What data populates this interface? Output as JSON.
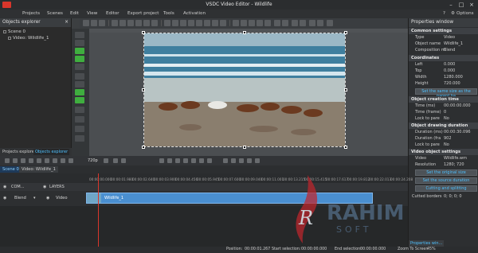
{
  "window": {
    "title": "VSDC Video Editor - Wildlife"
  },
  "menu": [
    "Projects",
    "Scenes",
    "Edit",
    "View",
    "Editor",
    "Export project",
    "Tools",
    "Activation"
  ],
  "menu_right": {
    "help": "?",
    "options": "Options"
  },
  "explorer": {
    "title": "Objects explorer",
    "close": "×",
    "tree": [
      {
        "label": "Scene 0"
      },
      {
        "label": "Video: Wildlife_1"
      }
    ],
    "tabs": [
      "Projects explorer",
      "Objects explorer"
    ]
  },
  "properties": {
    "title": "Properties window",
    "sections": [
      {
        "title": "Common settings",
        "rows": [
          {
            "key": "Type",
            "value": "Video"
          },
          {
            "key": "Object name",
            "value": "Wildlife_1"
          },
          {
            "key": "Composition m",
            "value": "Blend"
          }
        ]
      },
      {
        "title": "Coordinates",
        "rows": [
          {
            "key": "Left",
            "value": "0.000"
          },
          {
            "key": "Top",
            "value": "0.000"
          },
          {
            "key": "Width",
            "value": "1280.000"
          },
          {
            "key": "Height",
            "value": "720.000"
          }
        ],
        "button": "Set the same size as the parent ha"
      },
      {
        "title": "Object creation time",
        "rows": [
          {
            "key": "Time (ms)",
            "value": "00:00:00.000"
          },
          {
            "key": "Time (frame)",
            "value": "0"
          },
          {
            "key": "Lock to pare",
            "value": "No"
          }
        ]
      },
      {
        "title": "Object drawing duration",
        "rows": [
          {
            "key": "Duration (ms)",
            "value": "00:00:30.096"
          },
          {
            "key": "Duration (fra",
            "value": "902"
          },
          {
            "key": "Lock to pare",
            "value": "No"
          }
        ]
      },
      {
        "title": "Video object settings",
        "rows": [
          {
            "key": "Video",
            "value": "Wildlife.wm"
          },
          {
            "key": "Resolution",
            "value": "1280; 720"
          }
        ]
      }
    ],
    "buttons": [
      "Set the original size",
      "Set the source duration",
      "Cutting and splitting"
    ],
    "cutted_borders": {
      "key": "Cutted borders",
      "value": "0; 0; 0; 0"
    },
    "bottom_tab": "Properties win..."
  },
  "transport": {
    "zoom": "720p"
  },
  "scene_tabs": [
    "Scene 0",
    "Video: Wildlife_1"
  ],
  "time_ticks": [
    "00:00:00.000",
    "00:00:01.980",
    "00:00:02.640",
    "00:00:03.900",
    "00:00:04.456",
    "00:00:05.945",
    "00:00:07.600",
    "00:00:09.040",
    "00:00:11.001",
    "00:00:13.215",
    "00:00:15.415",
    "00:00:17.617",
    "00:00:19.812",
    "00:00:22.013",
    "00:00:24.208"
  ],
  "layers": {
    "header": "LAYERS",
    "com": "COM...",
    "blend": "Blend",
    "track": "Video",
    "clip_name": "Wildlife_1"
  },
  "status": {
    "position_label": "Position:",
    "position": "00:00:01.267",
    "start_label": "Start selection:",
    "start": "00:00:00.000",
    "end_label": "End selection:",
    "end": "00:00:00.000",
    "zoom_label": "Zoom To Screen",
    "zoom": "45%"
  },
  "watermark": {
    "text": "RAHIM",
    "sub": "SOFT",
    "letter": "R"
  },
  "colors": {
    "accent": "#4fc1ff",
    "clip": "#4a8fd0",
    "cursor": "#d9362b"
  }
}
